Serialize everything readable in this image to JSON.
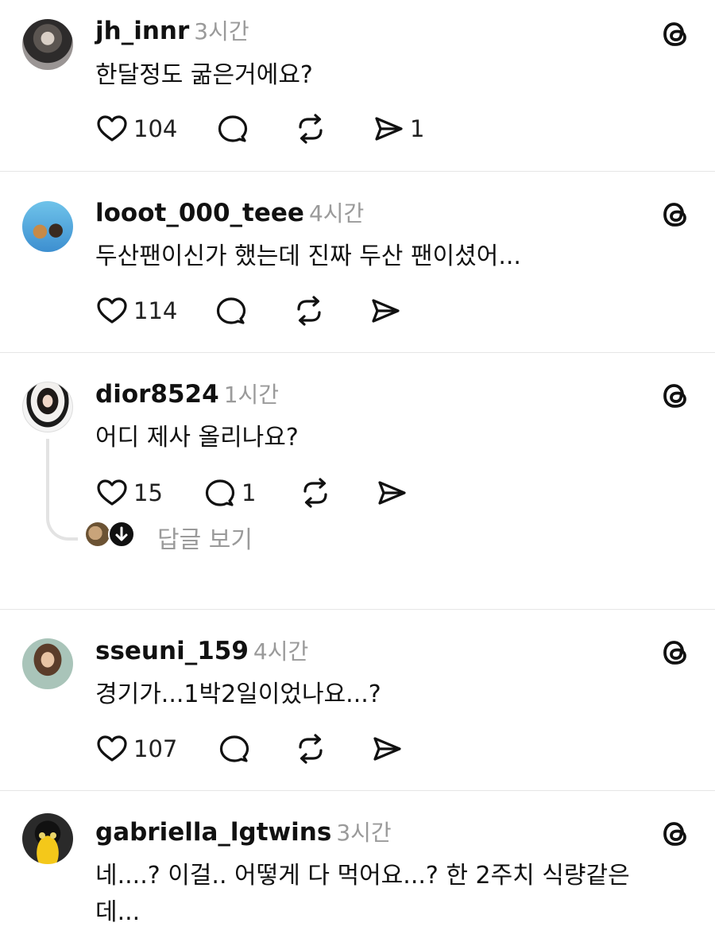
{
  "posts": [
    {
      "username": "jh_innr",
      "time": "3시간",
      "text": "한달정도 굶은거에요?",
      "likes": "104",
      "comments": "",
      "shares": "1"
    },
    {
      "username": "looot_000_teee",
      "time": "4시간",
      "text": "두산팬이신가 했는데 진짜 두산 팬이셨어...",
      "likes": "114",
      "comments": "",
      "shares": ""
    },
    {
      "username": "dior8524",
      "time": "1시간",
      "text": "어디 제사 올리나요?",
      "likes": "15",
      "comments": "1",
      "shares": "",
      "reply_label": "답글 보기"
    },
    {
      "username": "sseuni_159",
      "time": "4시간",
      "text": "경기가...1박2일이었나요...?",
      "likes": "107",
      "comments": "",
      "shares": ""
    },
    {
      "username": "gabriella_lgtwins",
      "time": "3시간",
      "text": "네....? 이걸.. 어떻게 다 먹어요...? 한 2주치 식량같은데...",
      "likes": "",
      "comments": "",
      "shares": ""
    }
  ],
  "icons": {
    "like": "heart-icon",
    "comment": "comment-bubble-icon",
    "repost": "repost-icon",
    "share": "send-icon",
    "platform": "threads-logo-icon"
  }
}
